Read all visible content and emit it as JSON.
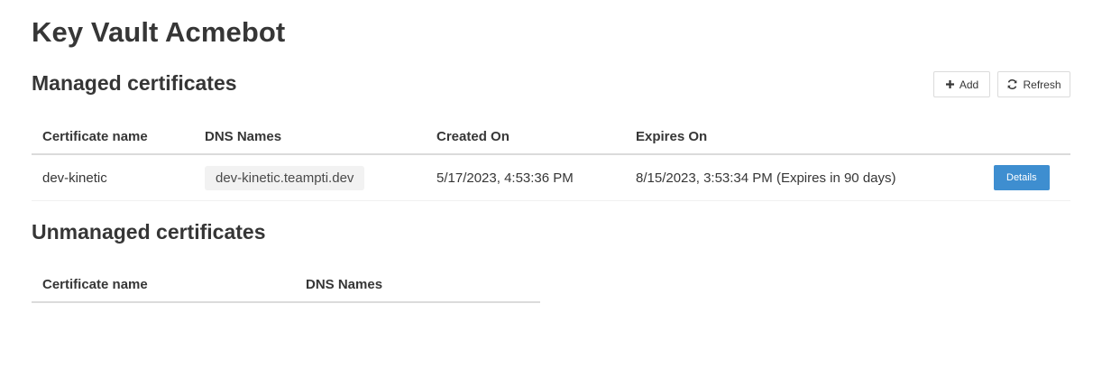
{
  "app": {
    "title": "Key Vault Acmebot"
  },
  "managed": {
    "title": "Managed certificates",
    "add_label": "Add",
    "refresh_label": "Refresh",
    "columns": [
      "Certificate name",
      "DNS Names",
      "Created On",
      "Expires On"
    ],
    "rows": [
      {
        "name": "dev-kinetic",
        "dns": "dev-kinetic.teampti.dev",
        "created": "5/17/2023, 4:53:36 PM",
        "expires": "8/15/2023, 3:53:34 PM (Expires in 90 days)",
        "action_label": "Details"
      }
    ]
  },
  "unmanaged": {
    "title": "Unmanaged certificates",
    "columns": [
      "Certificate name",
      "DNS Names"
    ]
  },
  "colors": {
    "accent": "#3e8ed0",
    "text": "#363636",
    "tag_bg": "#f2f2f2",
    "border": "#dbdbdb"
  },
  "icons": {
    "add": "plus-icon",
    "refresh": "refresh-icon"
  }
}
